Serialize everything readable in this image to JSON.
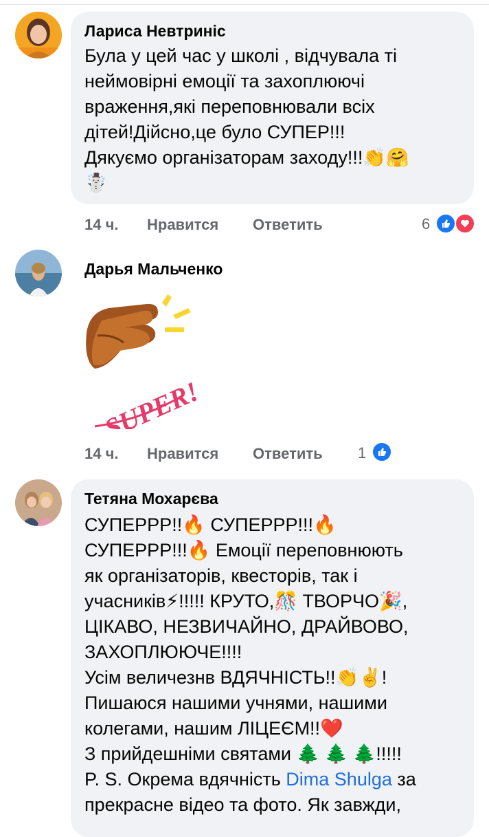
{
  "comments": [
    {
      "author": "Лариса Невтриніс",
      "lines": [
        "Була у цей час у школі , відчувала ті",
        "неймовірні емоції та захоплюючі",
        "враження,які переповнювали всіх",
        "дітей!Дійсно,це було СУПЕР!!!",
        "Дякуємо організаторам заходу!!!",
        ""
      ],
      "time": "14 ч.",
      "like": "Нравится",
      "reply": "Ответить",
      "reaction_count": "6"
    },
    {
      "author": "Дарья Мальченко",
      "sticker_text": "SUPER!",
      "time": "14 ч.",
      "like": "Нравится",
      "reply": "Ответить",
      "reaction_count": "1"
    },
    {
      "author": "Тетяна Мохарєва",
      "lines": [
        "СУПЕРРР!!",
        "СУПЕРРР!!!",
        "СУПЕРРР!!!",
        "Емоції переповнюють",
        "як організаторів, квесторів, так і",
        "учасників",
        "!!!!! КРУТО,",
        "ТВОРЧО",
        ",",
        "ЦІКАВО, НЕЗВИЧАЙНО, ДРАЙВОВО,",
        "ЗАХОПЛЮЮЧЕ!!!!",
        " Усім величезнв ВДЯЧНІСТЬ!!",
        "!",
        "Пишаюся  нашими учнями, нашими",
        "колегами, нашим ЛІЦЕЄМ!!",
        "З прийдешніми святами",
        "!!!!!",
        "P. S. Окрема вдячність ",
        "Dima Shulga",
        "  за",
        "прекрасне відео та фото. Як завжди,"
      ]
    }
  ],
  "icons": [
    "clap-icon",
    "hug-face-icon",
    "snowman-icon",
    "fire-icon",
    "lightning-icon",
    "confetti-icon",
    "party-popper-icon",
    "victory-hand-icon",
    "heart-icon",
    "tree-icon",
    "like-icon",
    "love-icon"
  ],
  "colors": {
    "bubble": "#f0f2f5",
    "meta": "#65676b",
    "like": "#1877f2",
    "love": "#f33e58",
    "mention": "#216fdb"
  }
}
